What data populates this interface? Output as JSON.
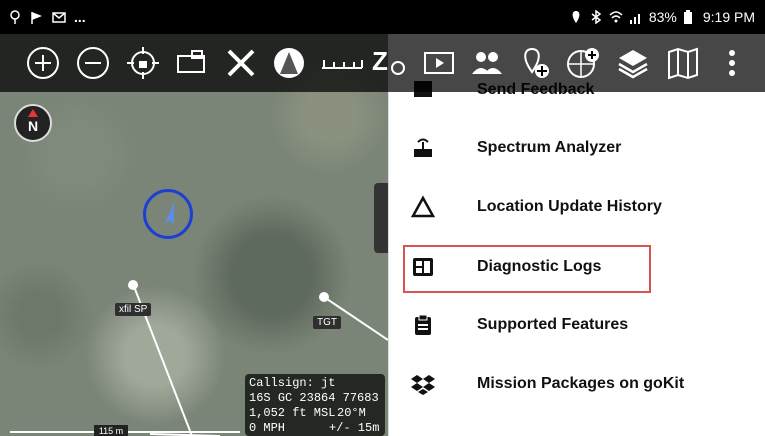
{
  "status_bar": {
    "left_dots": "...",
    "battery": "83%",
    "time": "9:19 PM"
  },
  "toolbar": {
    "icons": [
      "zoom-in",
      "zoom-out",
      "gps-lock",
      "map-tile",
      "close",
      "map-source",
      "ruler",
      "z-pin",
      "video",
      "contacts",
      "add-point",
      "add-overlay",
      "layers",
      "map",
      "more"
    ]
  },
  "map": {
    "compass_label": "N",
    "label_xfil": "xfil SP",
    "label_tgt": "TGT",
    "scale_label": "115 m",
    "info": {
      "callsign": "Callsign: jt",
      "grid_zone": "16S",
      "grid_square": "GC",
      "easting": "23864",
      "northing": "77683",
      "altitude": "1,052 ft MSL",
      "heading": "20°M",
      "speed": "0 MPH",
      "accuracy": "+/- 15m"
    }
  },
  "menu": {
    "items": [
      {
        "label": "Send Feedback",
        "icon": "feedback-icon"
      },
      {
        "label": "Spectrum Analyzer",
        "icon": "router-icon"
      },
      {
        "label": "Location Update History",
        "icon": "triangle-icon"
      },
      {
        "label": "Diagnostic Logs",
        "icon": "logs-icon"
      },
      {
        "label": "Supported Features",
        "icon": "clipboard-icon"
      },
      {
        "label": "Mission Packages on goKit",
        "icon": "dropbox-icon"
      }
    ],
    "highlight_color": "#d9534f"
  },
  "colors": {
    "toolbar_bg": "#000000",
    "self_marker": "#1c3fd6",
    "self_arrow": "#5b8ee6"
  }
}
